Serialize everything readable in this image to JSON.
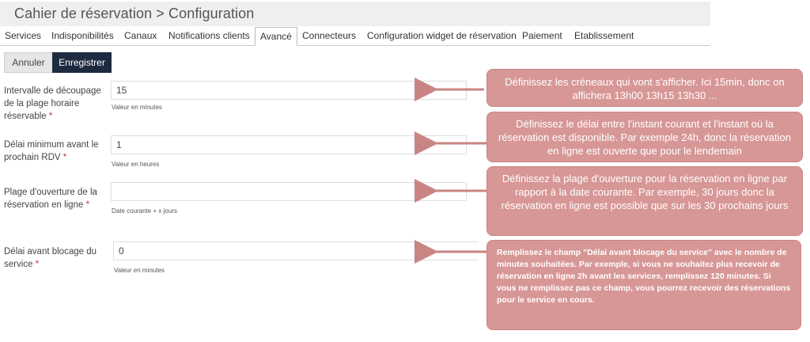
{
  "header": {
    "title": "Cahier de réservation > Configuration"
  },
  "tabs": [
    {
      "label": "Services"
    },
    {
      "label": "Indisponibilités"
    },
    {
      "label": "Canaux"
    },
    {
      "label": "Notifications clients"
    },
    {
      "label": "Avancé"
    },
    {
      "label": "Connecteurs"
    },
    {
      "label": "Configuration widget de réservation"
    },
    {
      "label": "Paiement"
    },
    {
      "label": "Etablissement"
    }
  ],
  "active_tab": "Avancé",
  "toolbar": {
    "cancel_label": "Annuler",
    "save_label": "Enregistrer"
  },
  "form": {
    "fields": [
      {
        "label_lines": [
          "Intervalle de découpage",
          "de la plage horaire",
          "réservable"
        ],
        "required": "*",
        "value": "15",
        "help": "Valeur en minutes"
      },
      {
        "label_lines": [
          "Délai minimum avant le",
          "prochain RDV"
        ],
        "required": "*",
        "value": "1",
        "help": "Valeur en heures"
      },
      {
        "label_lines": [
          "Plage d'ouverture de la",
          "réservation en ligne"
        ],
        "required": "*",
        "value": "",
        "help": "Date courante + x jours"
      },
      {
        "label_lines": [
          "Délai avant blocage du",
          "service"
        ],
        "required": "*",
        "value": "0",
        "help": "Valeur en minutes"
      }
    ]
  },
  "callouts": [
    {
      "text": "Définissez les créneaux qui vont s'afficher. Ici 15min, donc on affichera 13h00 13h15  13h30 ..."
    },
    {
      "text": "Définissez le délai entre l'instant courant et l'instant où la réservation est disponible. Par exemple 24h, donc la réservation en ligne est ouverte que pour le lendemain"
    },
    {
      "text": "Définissez la plage d'ouverture pour la réservation en ligne par rapport à la date courante. Par exemple, 30 jours donc la réservation en ligne est possible que sur les 30 prochains jours"
    },
    {
      "text": "Remplissez le champ \"Délai avant blocage du service\" avec le nombre de minutes souhaitées. Par exemple, si vous ne souhaitez plus recevoir de réservation en ligne 2h avant les services, remplissez 120 minutes. Si vous ne remplissez pas ce champ, vous pourrez recevoir des réservations pour le service en cours."
    }
  ],
  "colors": {
    "callout_bg": "#d79796",
    "save_button_bg": "#1d2a3f",
    "required": "#c0392b"
  }
}
